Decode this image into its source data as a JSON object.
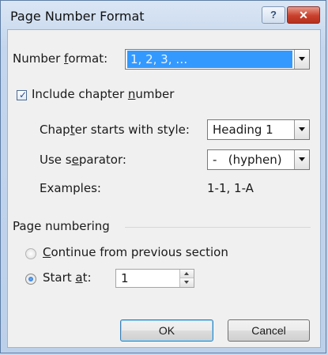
{
  "window": {
    "title": "Page Number Format",
    "help_label": "?",
    "close_label": "✕"
  },
  "number_format": {
    "label_pre": "Number ",
    "label_key": "f",
    "label_post": "ormat:",
    "value": "1, 2, 3, …"
  },
  "chapter": {
    "checkbox_pre": "Include chapter ",
    "checkbox_key": "n",
    "checkbox_post": "umber",
    "checked": true,
    "style_label_pre": "Chap",
    "style_label_key": "t",
    "style_label_post": "er starts with style:",
    "style_value": "Heading 1",
    "sep_label_pre": "Use s",
    "sep_label_key": "e",
    "sep_label_post": "parator:",
    "sep_value": "-   (hyphen)",
    "examples_label": "Examples:",
    "examples_value": "1-1, 1-A"
  },
  "page_numbering": {
    "group_label": "Page numbering",
    "continue_key": "C",
    "continue_post": "ontinue from previous section",
    "continue_selected": false,
    "start_pre": "Start ",
    "start_key": "a",
    "start_post": "t:",
    "start_selected": true,
    "start_value": "1"
  },
  "buttons": {
    "ok": "OK",
    "cancel": "Cancel"
  }
}
